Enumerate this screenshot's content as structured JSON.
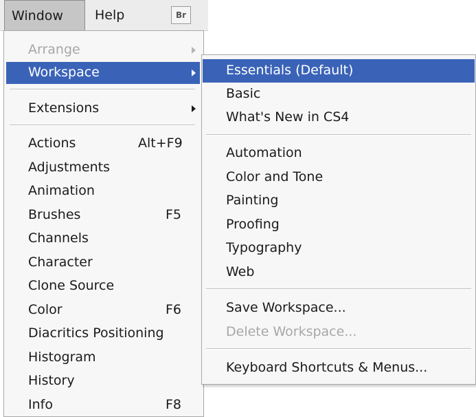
{
  "menubar": {
    "window_label": "Window",
    "help_label": "Help",
    "bridge_label": "Br"
  },
  "window_menu": {
    "arrange": "Arrange",
    "workspace": "Workspace",
    "extensions": "Extensions",
    "items": [
      {
        "label": "Actions",
        "shortcut": "Alt+F9"
      },
      {
        "label": "Adjustments",
        "shortcut": ""
      },
      {
        "label": "Animation",
        "shortcut": ""
      },
      {
        "label": "Brushes",
        "shortcut": "F5"
      },
      {
        "label": "Channels",
        "shortcut": ""
      },
      {
        "label": "Character",
        "shortcut": ""
      },
      {
        "label": "Clone Source",
        "shortcut": ""
      },
      {
        "label": "Color",
        "shortcut": "F6"
      },
      {
        "label": "Diacritics Positioning",
        "shortcut": ""
      },
      {
        "label": "Histogram",
        "shortcut": ""
      },
      {
        "label": "History",
        "shortcut": ""
      },
      {
        "label": "Info",
        "shortcut": "F8"
      }
    ]
  },
  "workspace_menu": {
    "essentials": "Essentials (Default)",
    "basic": "Basic",
    "whats_new": "What's New in CS4",
    "automation": "Automation",
    "color_and_tone": "Color and Tone",
    "painting": "Painting",
    "proofing": "Proofing",
    "typography": "Typography",
    "web": "Web",
    "save_workspace": "Save Workspace...",
    "delete_workspace": "Delete Workspace...",
    "keyboard_shortcuts": "Keyboard Shortcuts & Menus..."
  },
  "colors": {
    "highlight": "#3a63b8",
    "menu_bg": "#f7f7f7",
    "disabled_text": "#a7a7a7"
  }
}
